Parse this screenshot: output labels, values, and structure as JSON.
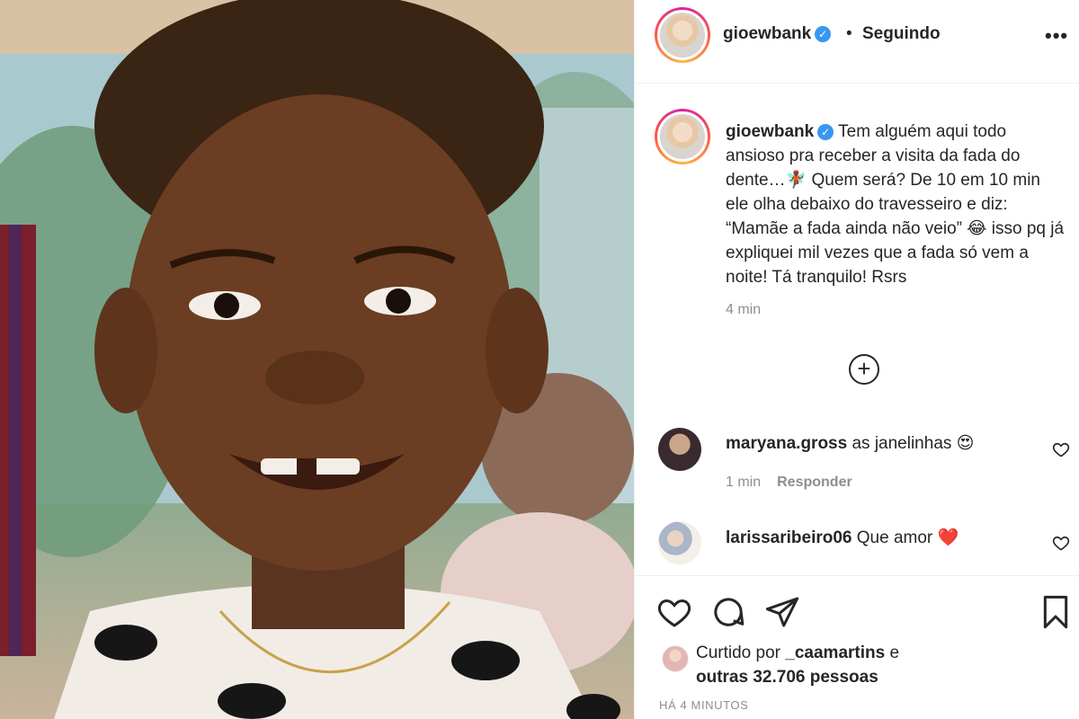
{
  "header": {
    "username": "gioewbank",
    "separator": "•",
    "follow_status": "Seguindo",
    "more_label": "•••"
  },
  "caption": {
    "username": "gioewbank",
    "text": "Tem alguém aqui todo ansioso pra receber a visita da fada do dente…🧚🏿 Quem será? De 10 em 10 min ele olha debaixo do travesseiro e diz: “Mamãe a fada ainda não veio” 😂 isso pq já expliquei mil vezes que a fada só vem a noite! Tá tranquilo! Rsrs",
    "time": "4 min"
  },
  "load_more_label": "+",
  "comments": [
    {
      "username": "maryana.gross",
      "text": "as janelinhas 😍",
      "time": "1 min",
      "reply_label": "Responder"
    },
    {
      "username": "larissaribeiro06",
      "text": "Que amor ❤️"
    }
  ],
  "likes": {
    "prefix": "Curtido por",
    "user": "_caamartins",
    "suffix": "e",
    "others": "outras 32.706 pessoas"
  },
  "post_time": "HÁ 4 MINUTOS",
  "icons": [
    "heart-icon",
    "comment-icon",
    "share-icon",
    "bookmark-icon",
    "verified-icon",
    "more-icon",
    "add-circle-icon"
  ],
  "colors": {
    "verified": "#3897f0",
    "secondary_text": "#8e8e8e",
    "border": "#efefef"
  }
}
